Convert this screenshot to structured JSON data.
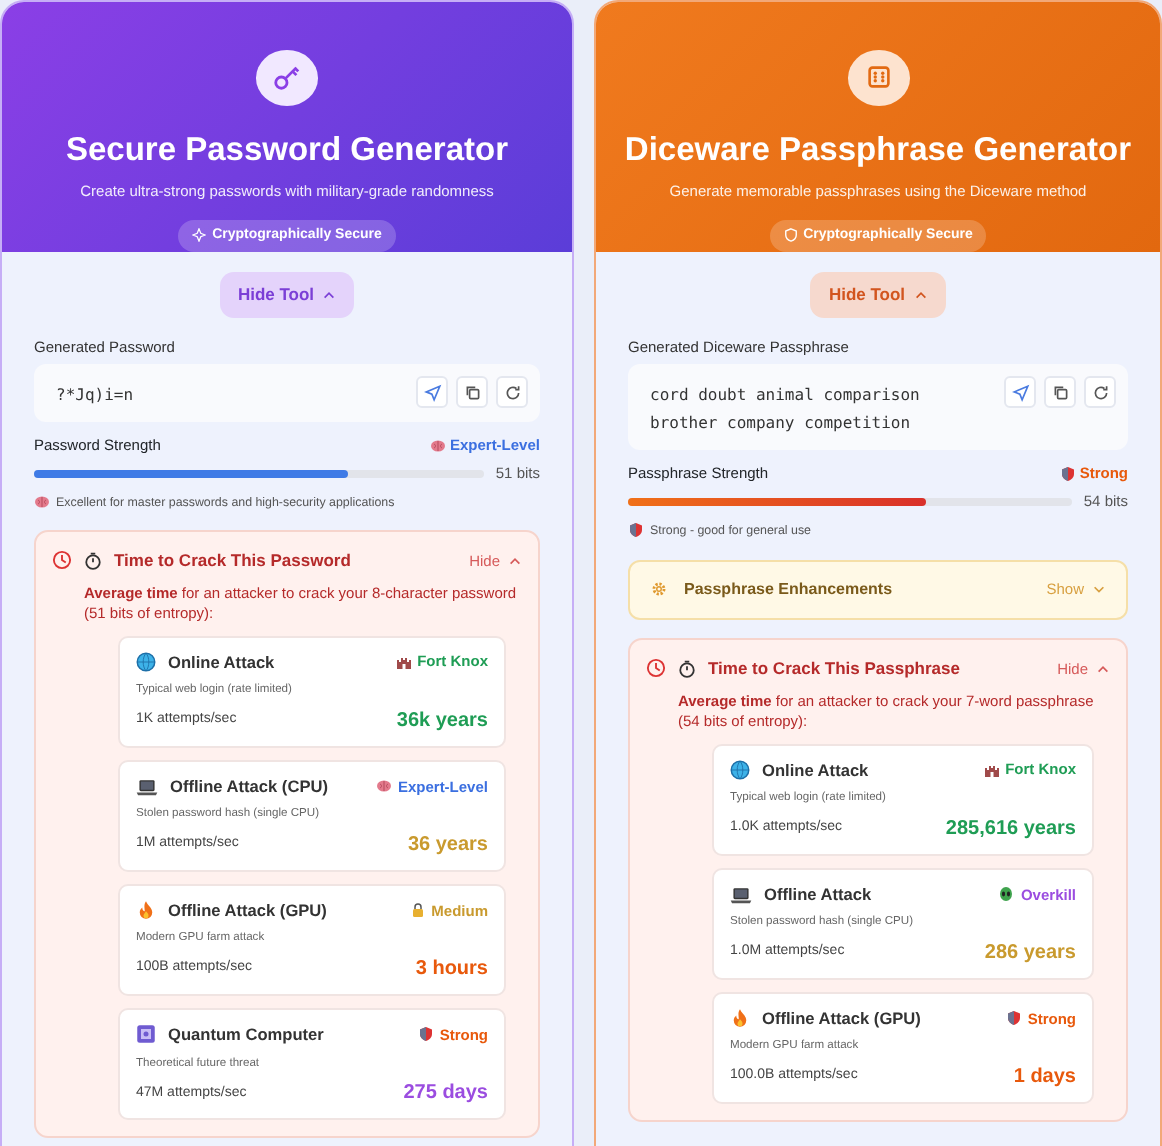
{
  "panels": [
    {
      "kind": "purple",
      "title": "Secure Password Generator",
      "subtitle": "Create ultra-strong passwords with military-grade randomness",
      "badge": "Cryptographically Secure",
      "toggle_button": "Hide Tool",
      "field_label": "Generated Password",
      "value": "?*Jq)i=n",
      "strength_label": "Password Strength",
      "rating": {
        "text": "Expert-Level",
        "kind": "brain",
        "color": "#3b6fe0"
      },
      "level": 0.7,
      "bits": "51 bits",
      "note": {
        "text": "Excellent for master passwords and high-security applications",
        "kind": "brain"
      },
      "crack": {
        "title": "Time to Crack This Password",
        "toggle": "Hide",
        "intro": "**Average time** for an attacker to crack your 8-character password (51 bits of entropy):",
        "attacks": [
          {
            "kind": "globe",
            "name": "Online Attack",
            "desc": "Typical web login (rate limited)",
            "rate": "1K attempts/sec",
            "time": {
              "text": "36k years",
              "color": "#1f9d55"
            },
            "rating": {
              "text": "Fort Knox",
              "kind": "castle",
              "color": "#1f9d55"
            }
          },
          {
            "kind": "laptop",
            "name": "Offline Attack (CPU)",
            "desc": "Stolen password hash (single CPU)",
            "rate": "1M attempts/sec",
            "time": {
              "text": "36 years",
              "color": "#c99a2e"
            },
            "rating": {
              "text": "Expert-Level",
              "kind": "brain",
              "color": "#3b6fe0"
            }
          },
          {
            "kind": "fire",
            "name": "Offline Attack (GPU)",
            "desc": "Modern GPU farm attack",
            "rate": "100B attempts/sec",
            "time": {
              "text": "3 hours",
              "color": "#e8590c"
            },
            "rating": {
              "text": "Medium",
              "kind": "lock",
              "color": "#c99a2e"
            }
          },
          {
            "kind": "chip",
            "name": "Quantum Computer",
            "desc": "Theoretical future threat",
            "rate": "47M attempts/sec",
            "time": {
              "text": "275 days",
              "color": "#9b4de0"
            },
            "rating": {
              "text": "Strong",
              "kind": "shield",
              "color": "#e8590c"
            }
          }
        ]
      }
    },
    {
      "kind": "orange",
      "title": "Diceware Passphrase Generator",
      "subtitle": "Generate memorable passphrases using the Diceware method",
      "badge": "Cryptographically Secure",
      "toggle_button": "Hide Tool",
      "field_label": "Generated Diceware Passphrase",
      "value": "cord doubt animal comparison brother company competition",
      "strength_label": "Passphrase Strength",
      "rating": {
        "text": "Strong",
        "kind": "shield",
        "color": "#e8590c"
      },
      "level": 0.67,
      "bits": "54 bits",
      "note": {
        "text": "Strong - good for general use",
        "kind": "shield"
      },
      "enhancements": {
        "title": "Passphrase Enhancements",
        "toggle": "Show"
      },
      "crack": {
        "title": "Time to Crack This Passphrase",
        "toggle": "Hide",
        "intro": "**Average time** for an attacker to crack your 7-word passphrase (54 bits of entropy):",
        "attacks": [
          {
            "kind": "globe",
            "name": "Online Attack",
            "desc": "Typical web login (rate limited)",
            "rate": "1.0K attempts/sec",
            "time": {
              "text": "285,616 years",
              "color": "#1f9d55"
            },
            "rating": {
              "text": "Fort Knox",
              "kind": "castle",
              "color": "#1f9d55"
            }
          },
          {
            "kind": "laptop",
            "name": "Offline Attack",
            "desc": "Stolen password hash (single CPU)",
            "rate": "1.0M attempts/sec",
            "time": {
              "text": "286 years",
              "color": "#c99a2e"
            },
            "rating": {
              "text": "Overkill",
              "kind": "alien",
              "color": "#9b4de0"
            }
          },
          {
            "kind": "fire",
            "name": "Offline Attack (GPU)",
            "desc": "Modern GPU farm attack",
            "rate": "100.0B attempts/sec",
            "time": {
              "text": "1 days",
              "color": "#e8590c"
            },
            "rating": {
              "text": "Strong",
              "kind": "shield",
              "color": "#e8590c"
            }
          }
        ]
      }
    }
  ]
}
